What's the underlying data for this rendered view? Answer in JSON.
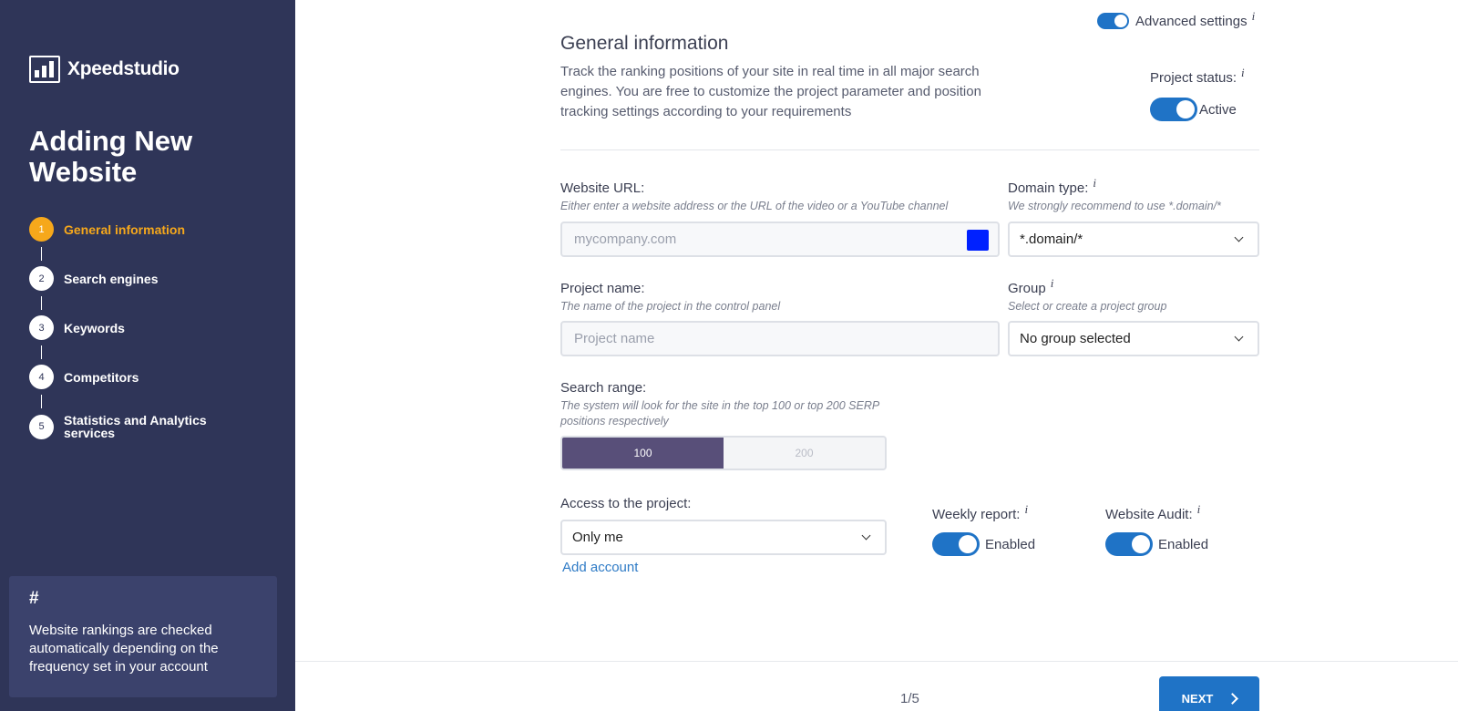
{
  "sidebar": {
    "logo_text": "Xpeedstudio",
    "title": "Adding New Website",
    "steps": [
      {
        "num": "1",
        "label": "General information"
      },
      {
        "num": "2",
        "label": "Search engines"
      },
      {
        "num": "3",
        "label": "Keywords"
      },
      {
        "num": "4",
        "label": "Competitors"
      },
      {
        "num": "5",
        "label": "Statistics and Analytics services"
      }
    ],
    "active_step": 1,
    "tip_symbol": "#",
    "tip_text": "Website rankings are checked automatically depending on the frequency set in your account"
  },
  "header": {
    "advanced_label": "Advanced settings",
    "info_glyph": "i"
  },
  "general": {
    "title": "General information",
    "description": "Track the ranking positions of your site in real time in all major search engines. You are free to customize the project parameter and position tracking settings according to your requirements",
    "status_label": "Project status:",
    "status_value": "Active"
  },
  "form": {
    "url_label": "Website URL:",
    "url_hint": "Either enter a website address or the URL of the video or a YouTube channel",
    "url_placeholder": "mycompany.com",
    "url_color": "#0021ff",
    "domain_label": "Domain type:",
    "domain_hint": "We strongly recommend to use *.domain/*",
    "domain_value": "*.domain/*",
    "project_label": "Project name:",
    "project_hint": "The name of the project in the control panel",
    "project_placeholder": "Project name",
    "group_label": "Group",
    "group_hint": "Select or create a project group",
    "group_value": "No group selected",
    "range_label": "Search range:",
    "range_hint": "The system will look for the site in the top 100 or top 200 SERP positions respectively",
    "range_options": [
      "100",
      "200"
    ],
    "access_label": "Access to the project:",
    "access_value": "Only me",
    "add_account": "Add account",
    "weekly_label": "Weekly report:",
    "weekly_value": "Enabled",
    "audit_label": "Website Audit:",
    "audit_value": "Enabled"
  },
  "footer": {
    "page_indicator": "1/5",
    "next_label": "NEXT"
  },
  "colors": {
    "sidebar_bg": "#2f3558",
    "accent": "#1f73c6",
    "active_step": "#f6a81b",
    "range_selected": "#584f79"
  }
}
